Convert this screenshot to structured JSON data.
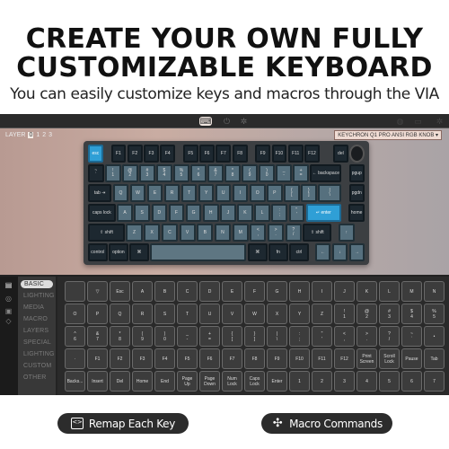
{
  "headline": {
    "line1": "CREATE YOUR OWN FULLY",
    "line2": "CUSTOMIZABLE KEYBOARD",
    "subtitle": "You can easily customize keys and macros through the VIA"
  },
  "app": {
    "topbar_icons": [
      "keyboard-icon",
      "plug-icon",
      "gear-icon",
      "bug-icon",
      "save-icon",
      "settings-icon"
    ],
    "layer_label": "LAYER",
    "layers": [
      "0",
      "1",
      "2",
      "3"
    ],
    "selected_layer": "0",
    "keyboard_select": "KEYCHRON Q1 PRO ANSI RGB KNOB ▾",
    "keyboard_rows": [
      [
        "esc",
        "F1",
        "F2",
        "F3",
        "F4",
        "F5",
        "F6",
        "F7",
        "F8",
        "F9",
        "F10",
        "F11",
        "F12",
        "del",
        "knob"
      ],
      [
        "~\n`",
        "!\n1",
        "@\n2",
        "#\n3",
        "$\n4",
        "%\n5",
        "^\n6",
        "&\n7",
        "*\n8",
        "(\n9",
        ")\n0",
        "_\n-",
        "+\n=",
        "← backspace",
        "pgup"
      ],
      [
        "tab ⇥",
        "Q",
        "W",
        "E",
        "R",
        "T",
        "Y",
        "U",
        "I",
        "O",
        "P",
        "{\n[",
        "}\n]",
        "|\n\\",
        "pgdn"
      ],
      [
        "caps lock",
        "A",
        "S",
        "D",
        "F",
        "G",
        "H",
        "J",
        "K",
        "L",
        ":\n;",
        "\"\n'",
        "↵ enter",
        "home"
      ],
      [
        "⇧ shift",
        "Z",
        "X",
        "C",
        "V",
        "B",
        "N",
        "M",
        "<\n,",
        ">\n.",
        "?\n/",
        "⇧ shift",
        "↑"
      ],
      [
        "control",
        "option",
        "⌘",
        "",
        "⌘",
        "fn",
        "ctrl",
        "←",
        "↓",
        "→"
      ]
    ],
    "colors": {
      "accent": "#2f9fd6",
      "alpha_key": "#56707e",
      "mod_key": "#1d2830"
    },
    "side_icons": [
      "keyboard-icon",
      "circle-icon",
      "save-icon",
      "gear-icon"
    ],
    "categories": [
      "BASIC",
      "LIGHTING",
      "MEDIA",
      "MACRO",
      "LAYERS",
      "SPECIAL",
      "LIGHTING",
      "CUSTOM",
      "OTHER"
    ],
    "selected_category": "BASIC",
    "keycodes": [
      [
        "",
        "▽",
        "Esc",
        "A",
        "B",
        "C",
        "D",
        "E",
        "F",
        "G",
        "H",
        "I",
        "J",
        "K",
        "L",
        "M",
        "N"
      ],
      [
        "O",
        "P",
        "Q",
        "R",
        "S",
        "T",
        "U",
        "V",
        "W",
        "X",
        "Y",
        "Z",
        "!\n1",
        "@\n2",
        "#\n3",
        "$\n4",
        "%\n5"
      ],
      [
        "^\n6",
        "&\n7",
        "*\n8",
        "(\n9",
        ")\n0",
        "_\n-",
        "+\n=",
        "{\n[",
        "}\n]",
        "|\n\\",
        ":\n;",
        "\"\n'",
        "<\n,",
        ">\n.",
        "?\n/",
        "~\n`",
        "•"
      ],
      [
        "·",
        "F1",
        "F2",
        "F3",
        "F4",
        "F5",
        "F6",
        "F7",
        "F8",
        "F9",
        "F10",
        "F11",
        "F12",
        "Print\nScreen",
        "Scroll\nLock",
        "Pause",
        "Tab"
      ],
      [
        "Backs...",
        "Insert",
        "Del",
        "Home",
        "End",
        "Page\nUp",
        "Page\nDown",
        "Num\nLock",
        "Caps\nLock",
        "Enter",
        "1",
        "2",
        "3",
        "4",
        "5",
        "6",
        "7"
      ]
    ]
  },
  "buttons": {
    "remap": "Remap Each Key",
    "macro": "Macro Commands"
  }
}
